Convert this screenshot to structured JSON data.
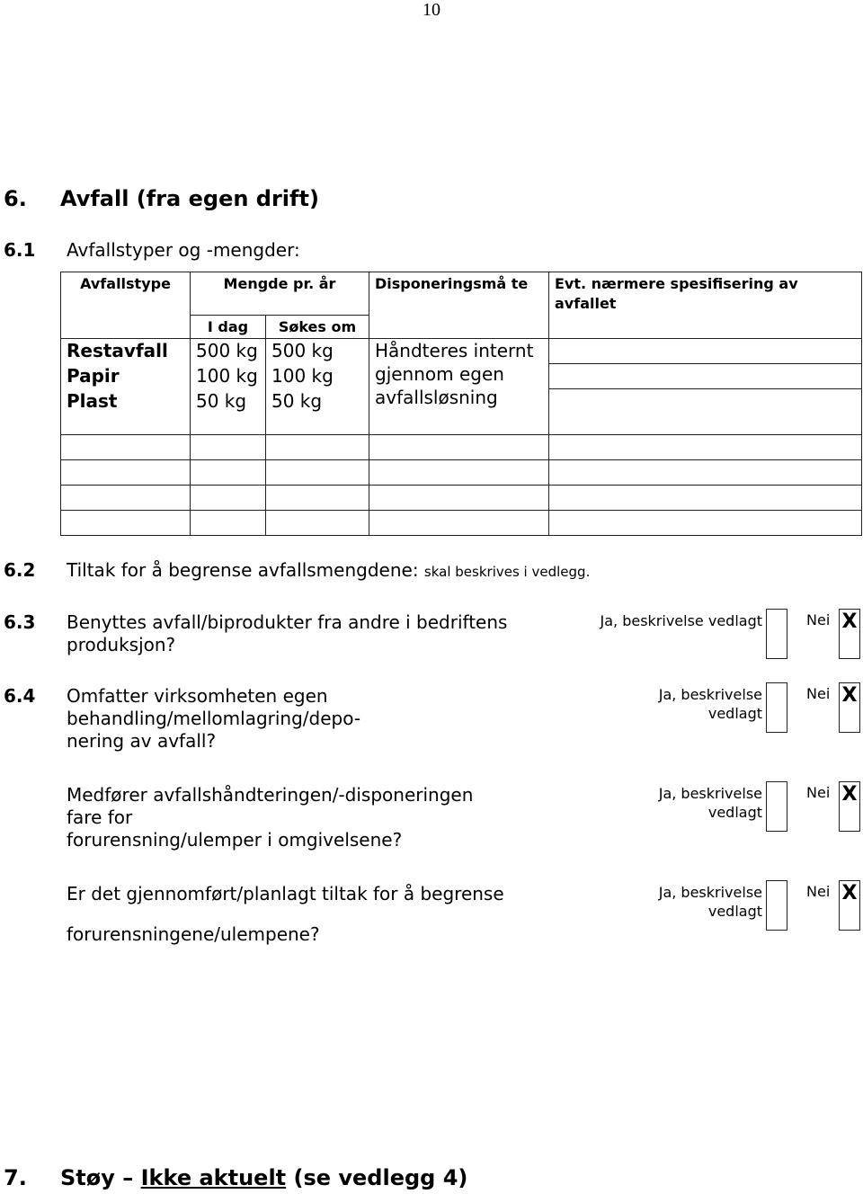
{
  "page_number": "10",
  "section6": {
    "number": "6.",
    "title": "Avfall (fra egen drift)"
  },
  "section6_1": {
    "number": "6.1",
    "title": "Avfallstyper og -mengder:"
  },
  "waste_table": {
    "headers": {
      "type": "Avfallstype",
      "amount": "Mengde pr. år",
      "amount_today": "I dag",
      "amount_requested": "Søkes om",
      "disposal": "Disponeringsmå te",
      "spec": "Evt. nærmere spesifisering av avfallet"
    },
    "rows": [
      {
        "type": "Restavfall",
        "today": "500 kg",
        "requested": "500 kg",
        "spec": ""
      },
      {
        "type": "Papir",
        "today": "100 kg",
        "requested": "100 kg",
        "spec": ""
      },
      {
        "type": "Plast",
        "today": "50 kg",
        "requested": "50 kg",
        "spec": ""
      }
    ],
    "disposal_merged": "Håndteres internt gjennom egen avfallsløsning",
    "empty_rows": 4
  },
  "section6_2": {
    "number": "6.2",
    "title": "Tiltak for å begrense avfallsmengdene:",
    "note": "skal beskrives i vedlegg."
  },
  "questions": [
    {
      "number": "6.3",
      "text_lines": [
        "Benyttes avfall/biprodukter fra andre i bedriftens",
        "produksjon?"
      ],
      "yes_label": "Ja, beskrivelse vedlagt",
      "no_label": "Nei",
      "yes_checked": false,
      "no_checked": true,
      "mark": "X"
    },
    {
      "number": "6.4",
      "text_lines": [
        "Omfatter virksomheten egen",
        "behandling/mellomlagring/depo-",
        "nering av avfall?"
      ],
      "yes_label_lines": [
        "Ja, beskrivelse",
        "vedlagt"
      ],
      "no_label": "Nei",
      "yes_checked": false,
      "no_checked": true,
      "mark": "X"
    },
    {
      "number": "",
      "text_lines": [
        "Medfører avfallshåndteringen/-disponeringen",
        "fare for",
        "forurensning/ulemper i omgivelsene?"
      ],
      "yes_label_lines": [
        "Ja, beskrivelse",
        "vedlagt"
      ],
      "no_label": "Nei",
      "yes_checked": false,
      "no_checked": true,
      "mark": "X"
    },
    {
      "number": "",
      "text_lines": [
        "Er det gjennomført/planlagt tiltak for å begrense",
        "forurensningene/ulempene?"
      ],
      "yes_label_lines": [
        "Ja, beskrivelse",
        "vedlagt"
      ],
      "no_label": "Nei",
      "yes_checked": false,
      "no_checked": true,
      "mark": "X"
    }
  ],
  "section7": {
    "number": "7.",
    "title_prefix": "Støy –",
    "title_underlined": "Ikke aktuelt",
    "title_suffix": "(se vedlegg 4)"
  }
}
